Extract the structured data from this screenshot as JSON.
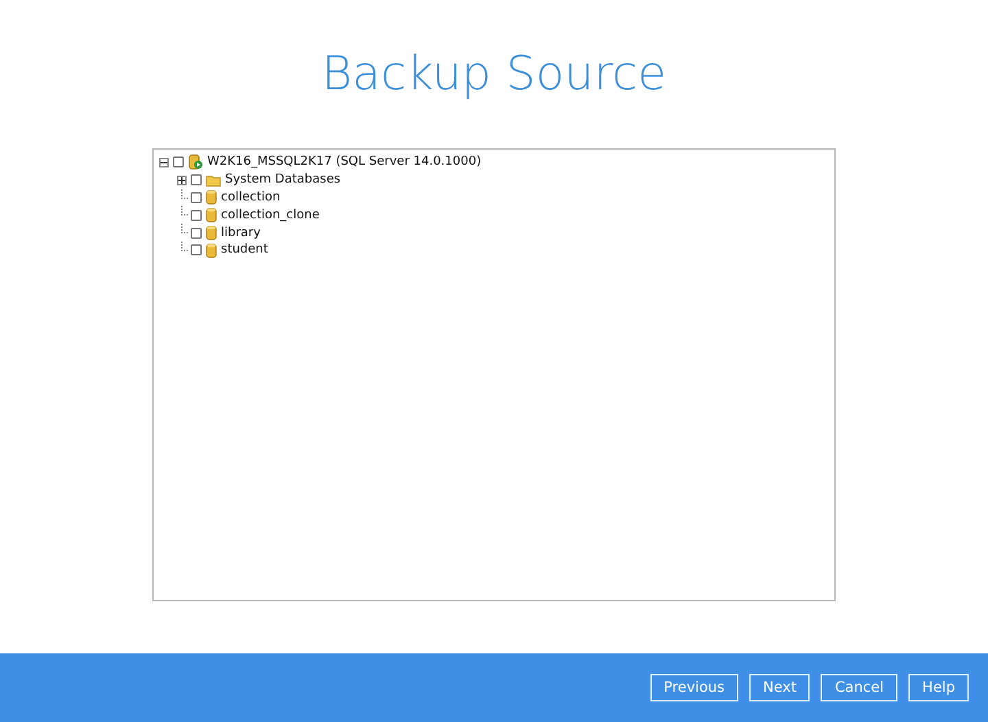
{
  "title": "Backup Source",
  "tree": [
    {
      "label": "W2K16_MSSQL2K17 (SQL Server 14.0.1000)",
      "kind": "server",
      "checked": false,
      "expanded": true,
      "children": [
        {
          "label": "System Databases",
          "kind": "folder",
          "checked": false,
          "expanded": false
        },
        {
          "label": "collection",
          "kind": "database",
          "checked": false
        },
        {
          "label": "collection_clone",
          "kind": "database",
          "checked": false
        },
        {
          "label": "library",
          "kind": "database",
          "checked": false
        },
        {
          "label": "student",
          "kind": "database",
          "checked": false
        }
      ]
    }
  ],
  "buttons": [
    "Previous",
    "Next",
    "Cancel",
    "Help"
  ]
}
